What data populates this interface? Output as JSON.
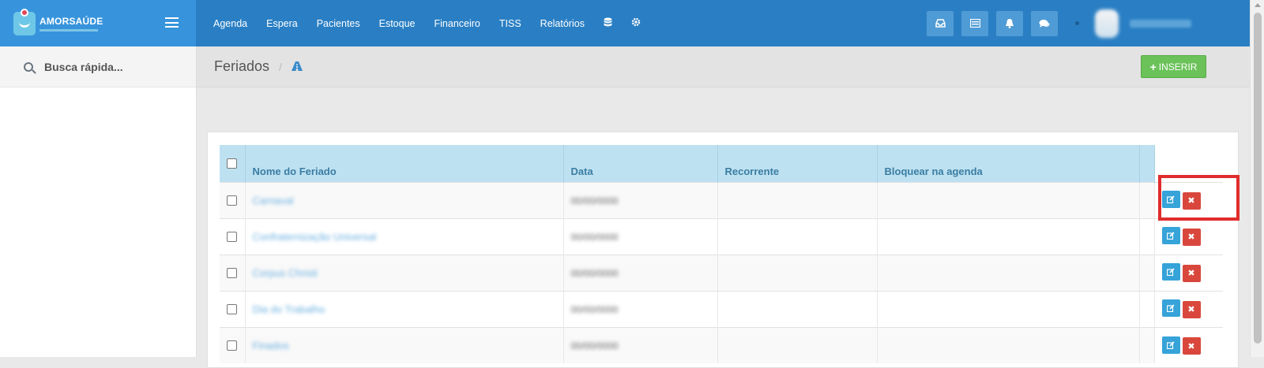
{
  "brand": {
    "name": "AMORSAÚDE"
  },
  "nav": {
    "items": [
      "Agenda",
      "Espera",
      "Pacientes",
      "Estoque",
      "Financeiro",
      "TISS",
      "Relatórios"
    ],
    "icons": [
      "database-icon",
      "gear-icon"
    ]
  },
  "topbar_icons": [
    "inbox-icon",
    "list-icon",
    "bell-icon",
    "chat-icon"
  ],
  "search": {
    "placeholder": "Busca rápida..."
  },
  "page": {
    "title": "Feriados",
    "insert_label": "INSERIR"
  },
  "table": {
    "headers": [
      "Nome do Feriado",
      "Data",
      "Recorrente",
      "Bloquear na agenda"
    ],
    "rows": 5
  },
  "colors": {
    "topbar": "#2a7fc4",
    "brand": "#3794dc",
    "insert": "#6ac259",
    "edit": "#36a3d9",
    "delete": "#d9473c",
    "highlight": "#e02c2c"
  }
}
